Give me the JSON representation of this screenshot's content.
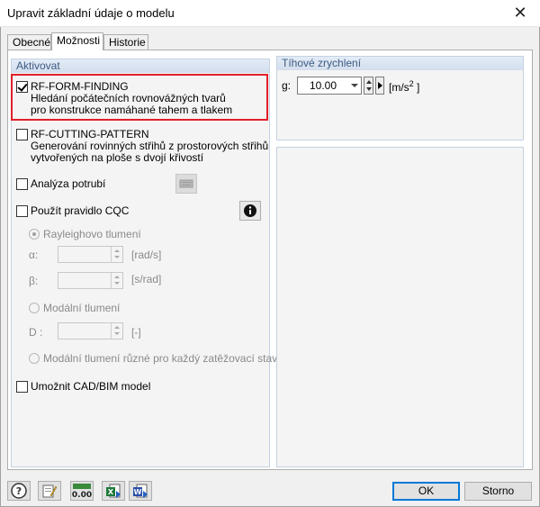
{
  "window": {
    "title": "Upravit základní údaje o modelu",
    "close_glyph": "✕"
  },
  "tabs": [
    {
      "label": "Obecné",
      "active": false
    },
    {
      "label": "Možnosti",
      "active": true
    },
    {
      "label": "Historie",
      "active": false
    }
  ],
  "activate_group": {
    "header": "Aktivovat",
    "form_finding": {
      "label": "RF-FORM-FINDING",
      "desc1": "Hledání počátečních rovnovážných tvarů",
      "desc2": "pro konstrukce namáhané tahem a tlakem",
      "checked": true
    },
    "cutting_pattern": {
      "label": "RF-CUTTING-PATTERN",
      "desc1": "Generování rovinných střihů z prostorových střihů",
      "desc2": "vytvořených na ploše s dvojí křivostí",
      "checked": false
    },
    "pipe_analysis": {
      "label": "Analýza potrubí",
      "checked": false
    },
    "cqc": {
      "label": "Použít pravidlo CQC",
      "checked": false
    },
    "rayleigh": {
      "label": "Rayleighovo tlumení",
      "selected": true
    },
    "alpha": {
      "symbol": "α:",
      "value": "",
      "unit": "[rad/s]"
    },
    "beta": {
      "symbol": "β:",
      "value": "",
      "unit": "[s/rad]"
    },
    "modal": {
      "label": "Modální tlumení",
      "selected": false
    },
    "d": {
      "symbol": "D :",
      "value": "",
      "unit": "[-]"
    },
    "modal_per_load": {
      "label": "Modální tlumení různé pro každý zatěžovací stav",
      "selected": false
    },
    "cad_bim": {
      "label": "Umožnit CAD/BIM model",
      "checked": false
    }
  },
  "gravity_group": {
    "header": "Tíhové zrychlení",
    "g_label": "g:",
    "g_value": "10.00",
    "unit_prefix": "[m/s",
    "unit_exp": "2",
    "unit_suffix": " ]"
  },
  "buttons": {
    "ok": "OK",
    "cancel": "Storno"
  },
  "bottom_icons": [
    "help-icon",
    "edit-icon",
    "units-icon",
    "excel-export-icon",
    "import-icon"
  ],
  "units_icon_text": "0.00",
  "colors": {
    "highlight": "#e0202a",
    "group_header_text": "#3c5a82",
    "default_button_border": "#0078d7"
  }
}
